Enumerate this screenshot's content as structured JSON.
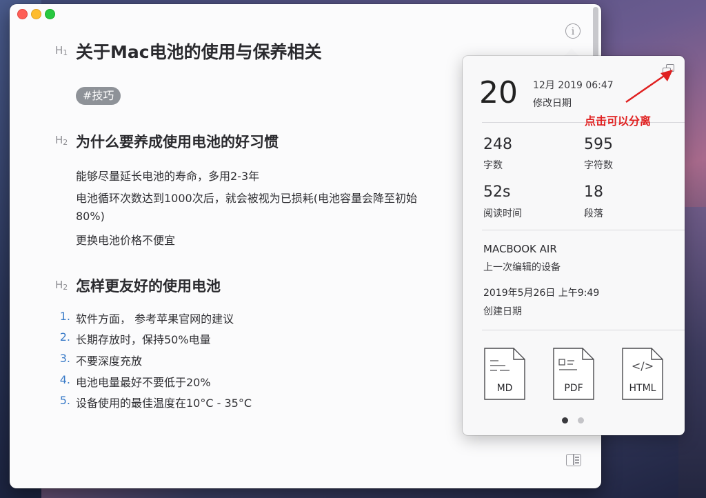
{
  "document": {
    "h1_marker": "H",
    "h1_marker_level": "1",
    "title": "关于Mac电池的使用与保养相关",
    "tag": "#技巧",
    "h2_marker": "H",
    "h2_marker_level": "2",
    "section1": {
      "heading": "为什么要养成使用电池的好习惯",
      "lines": [
        "能够尽量延长电池的寿命，多用2-3年",
        "电池循环次数达到1000次后，就会被视为已损耗(电池容量会降至初始",
        "80%)",
        "更换电池价格不便宜"
      ]
    },
    "section2": {
      "heading": "怎样更友好的使用电池",
      "items": [
        {
          "num": "1.",
          "text": "软件方面， 参考苹果官网的建议"
        },
        {
          "num": "2.",
          "text": "长期存放时，保持50%电量"
        },
        {
          "num": "3.",
          "text": "不要深度充放"
        },
        {
          "num": "4.",
          "text": "电池电量最好不要低于20%"
        },
        {
          "num": "5.",
          "text": "设备使用的最佳温度在10°C - 35°C"
        }
      ]
    }
  },
  "info_panel": {
    "day": "20",
    "modified_datetime": "12月 2019 06:47",
    "modified_label": "修改日期",
    "stats": [
      {
        "value": "248",
        "label": "字数"
      },
      {
        "value": "595",
        "label": "字符数"
      },
      {
        "value": "52s",
        "label": "阅读时间"
      },
      {
        "value": "18",
        "label": "段落"
      }
    ],
    "device_name": "MACBOOK AIR",
    "device_label": "上一次编辑的设备",
    "created_datetime": "2019年5月26日 上午9:49",
    "created_label": "创建日期",
    "exports": [
      "MD",
      "PDF",
      "HTML"
    ],
    "html_glyph": "</>",
    "page_dots": 2,
    "active_dot": 0
  },
  "annotation": {
    "text": "点击可以分离",
    "color": "#e02020"
  },
  "icons": {
    "info": "i",
    "detach": "detach-window-icon",
    "sidebar": "sidebar-toggle-icon"
  },
  "colors": {
    "list_number": "#3a7bc8",
    "tag_bg": "#8e9298",
    "close": "#fe5f57",
    "minimize": "#febc2e",
    "maximize": "#28c840"
  }
}
